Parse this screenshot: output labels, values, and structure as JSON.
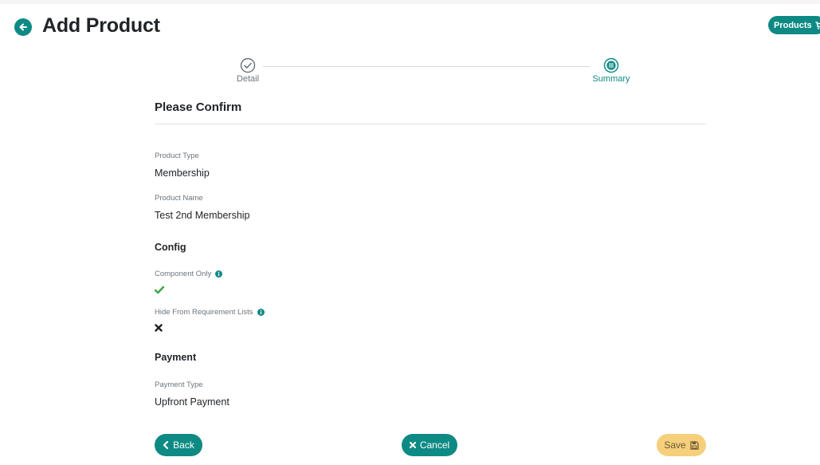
{
  "header": {
    "title": "Add Product",
    "products_button": "Products"
  },
  "stepper": {
    "steps": [
      {
        "label": "Detail",
        "state": "complete"
      },
      {
        "label": "Summary",
        "state": "active"
      }
    ]
  },
  "confirm": {
    "heading": "Please Confirm"
  },
  "fields": {
    "product_type": {
      "label": "Product Type",
      "value": "Membership"
    },
    "product_name": {
      "label": "Product Name",
      "value": "Test 2nd Membership"
    }
  },
  "config": {
    "heading": "Config",
    "component_only": {
      "label": "Component Only",
      "value": true,
      "icon": "check-icon"
    },
    "hide_from_requirement_lists": {
      "label": "Hide From Requirement Lists",
      "value": false,
      "icon": "x-icon"
    }
  },
  "payment": {
    "heading": "Payment",
    "payment_type": {
      "label": "Payment Type",
      "value": "Upfront Payment"
    }
  },
  "footer": {
    "back_label": "Back",
    "cancel_label": "Cancel",
    "save_label": "Save"
  },
  "colors": {
    "primary": "#0e8a84",
    "save": "#f6cf7c",
    "success": "#3aa53a"
  }
}
